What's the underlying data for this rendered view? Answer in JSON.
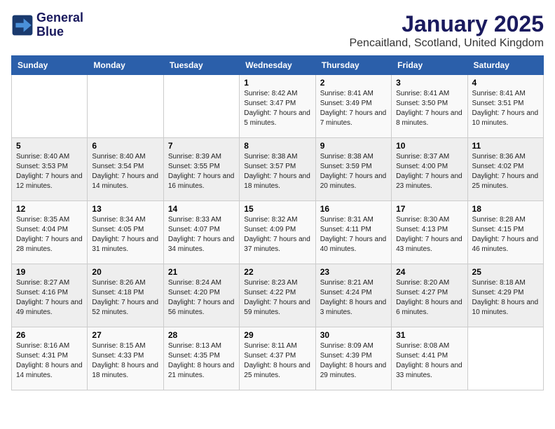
{
  "logo": {
    "line1": "General",
    "line2": "Blue"
  },
  "title": "January 2025",
  "location": "Pencaitland, Scotland, United Kingdom",
  "days_of_week": [
    "Sunday",
    "Monday",
    "Tuesday",
    "Wednesday",
    "Thursday",
    "Friday",
    "Saturday"
  ],
  "weeks": [
    [
      {
        "day": "",
        "sunrise": "",
        "sunset": "",
        "daylight": ""
      },
      {
        "day": "",
        "sunrise": "",
        "sunset": "",
        "daylight": ""
      },
      {
        "day": "",
        "sunrise": "",
        "sunset": "",
        "daylight": ""
      },
      {
        "day": "1",
        "sunrise": "Sunrise: 8:42 AM",
        "sunset": "Sunset: 3:47 PM",
        "daylight": "Daylight: 7 hours and 5 minutes."
      },
      {
        "day": "2",
        "sunrise": "Sunrise: 8:41 AM",
        "sunset": "Sunset: 3:49 PM",
        "daylight": "Daylight: 7 hours and 7 minutes."
      },
      {
        "day": "3",
        "sunrise": "Sunrise: 8:41 AM",
        "sunset": "Sunset: 3:50 PM",
        "daylight": "Daylight: 7 hours and 8 minutes."
      },
      {
        "day": "4",
        "sunrise": "Sunrise: 8:41 AM",
        "sunset": "Sunset: 3:51 PM",
        "daylight": "Daylight: 7 hours and 10 minutes."
      }
    ],
    [
      {
        "day": "5",
        "sunrise": "Sunrise: 8:40 AM",
        "sunset": "Sunset: 3:53 PM",
        "daylight": "Daylight: 7 hours and 12 minutes."
      },
      {
        "day": "6",
        "sunrise": "Sunrise: 8:40 AM",
        "sunset": "Sunset: 3:54 PM",
        "daylight": "Daylight: 7 hours and 14 minutes."
      },
      {
        "day": "7",
        "sunrise": "Sunrise: 8:39 AM",
        "sunset": "Sunset: 3:55 PM",
        "daylight": "Daylight: 7 hours and 16 minutes."
      },
      {
        "day": "8",
        "sunrise": "Sunrise: 8:38 AM",
        "sunset": "Sunset: 3:57 PM",
        "daylight": "Daylight: 7 hours and 18 minutes."
      },
      {
        "day": "9",
        "sunrise": "Sunrise: 8:38 AM",
        "sunset": "Sunset: 3:59 PM",
        "daylight": "Daylight: 7 hours and 20 minutes."
      },
      {
        "day": "10",
        "sunrise": "Sunrise: 8:37 AM",
        "sunset": "Sunset: 4:00 PM",
        "daylight": "Daylight: 7 hours and 23 minutes."
      },
      {
        "day": "11",
        "sunrise": "Sunrise: 8:36 AM",
        "sunset": "Sunset: 4:02 PM",
        "daylight": "Daylight: 7 hours and 25 minutes."
      }
    ],
    [
      {
        "day": "12",
        "sunrise": "Sunrise: 8:35 AM",
        "sunset": "Sunset: 4:04 PM",
        "daylight": "Daylight: 7 hours and 28 minutes."
      },
      {
        "day": "13",
        "sunrise": "Sunrise: 8:34 AM",
        "sunset": "Sunset: 4:05 PM",
        "daylight": "Daylight: 7 hours and 31 minutes."
      },
      {
        "day": "14",
        "sunrise": "Sunrise: 8:33 AM",
        "sunset": "Sunset: 4:07 PM",
        "daylight": "Daylight: 7 hours and 34 minutes."
      },
      {
        "day": "15",
        "sunrise": "Sunrise: 8:32 AM",
        "sunset": "Sunset: 4:09 PM",
        "daylight": "Daylight: 7 hours and 37 minutes."
      },
      {
        "day": "16",
        "sunrise": "Sunrise: 8:31 AM",
        "sunset": "Sunset: 4:11 PM",
        "daylight": "Daylight: 7 hours and 40 minutes."
      },
      {
        "day": "17",
        "sunrise": "Sunrise: 8:30 AM",
        "sunset": "Sunset: 4:13 PM",
        "daylight": "Daylight: 7 hours and 43 minutes."
      },
      {
        "day": "18",
        "sunrise": "Sunrise: 8:28 AM",
        "sunset": "Sunset: 4:15 PM",
        "daylight": "Daylight: 7 hours and 46 minutes."
      }
    ],
    [
      {
        "day": "19",
        "sunrise": "Sunrise: 8:27 AM",
        "sunset": "Sunset: 4:16 PM",
        "daylight": "Daylight: 7 hours and 49 minutes."
      },
      {
        "day": "20",
        "sunrise": "Sunrise: 8:26 AM",
        "sunset": "Sunset: 4:18 PM",
        "daylight": "Daylight: 7 hours and 52 minutes."
      },
      {
        "day": "21",
        "sunrise": "Sunrise: 8:24 AM",
        "sunset": "Sunset: 4:20 PM",
        "daylight": "Daylight: 7 hours and 56 minutes."
      },
      {
        "day": "22",
        "sunrise": "Sunrise: 8:23 AM",
        "sunset": "Sunset: 4:22 PM",
        "daylight": "Daylight: 7 hours and 59 minutes."
      },
      {
        "day": "23",
        "sunrise": "Sunrise: 8:21 AM",
        "sunset": "Sunset: 4:24 PM",
        "daylight": "Daylight: 8 hours and 3 minutes."
      },
      {
        "day": "24",
        "sunrise": "Sunrise: 8:20 AM",
        "sunset": "Sunset: 4:27 PM",
        "daylight": "Daylight: 8 hours and 6 minutes."
      },
      {
        "day": "25",
        "sunrise": "Sunrise: 8:18 AM",
        "sunset": "Sunset: 4:29 PM",
        "daylight": "Daylight: 8 hours and 10 minutes."
      }
    ],
    [
      {
        "day": "26",
        "sunrise": "Sunrise: 8:16 AM",
        "sunset": "Sunset: 4:31 PM",
        "daylight": "Daylight: 8 hours and 14 minutes."
      },
      {
        "day": "27",
        "sunrise": "Sunrise: 8:15 AM",
        "sunset": "Sunset: 4:33 PM",
        "daylight": "Daylight: 8 hours and 18 minutes."
      },
      {
        "day": "28",
        "sunrise": "Sunrise: 8:13 AM",
        "sunset": "Sunset: 4:35 PM",
        "daylight": "Daylight: 8 hours and 21 minutes."
      },
      {
        "day": "29",
        "sunrise": "Sunrise: 8:11 AM",
        "sunset": "Sunset: 4:37 PM",
        "daylight": "Daylight: 8 hours and 25 minutes."
      },
      {
        "day": "30",
        "sunrise": "Sunrise: 8:09 AM",
        "sunset": "Sunset: 4:39 PM",
        "daylight": "Daylight: 8 hours and 29 minutes."
      },
      {
        "day": "31",
        "sunrise": "Sunrise: 8:08 AM",
        "sunset": "Sunset: 4:41 PM",
        "daylight": "Daylight: 8 hours and 33 minutes."
      },
      {
        "day": "",
        "sunrise": "",
        "sunset": "",
        "daylight": ""
      }
    ]
  ]
}
